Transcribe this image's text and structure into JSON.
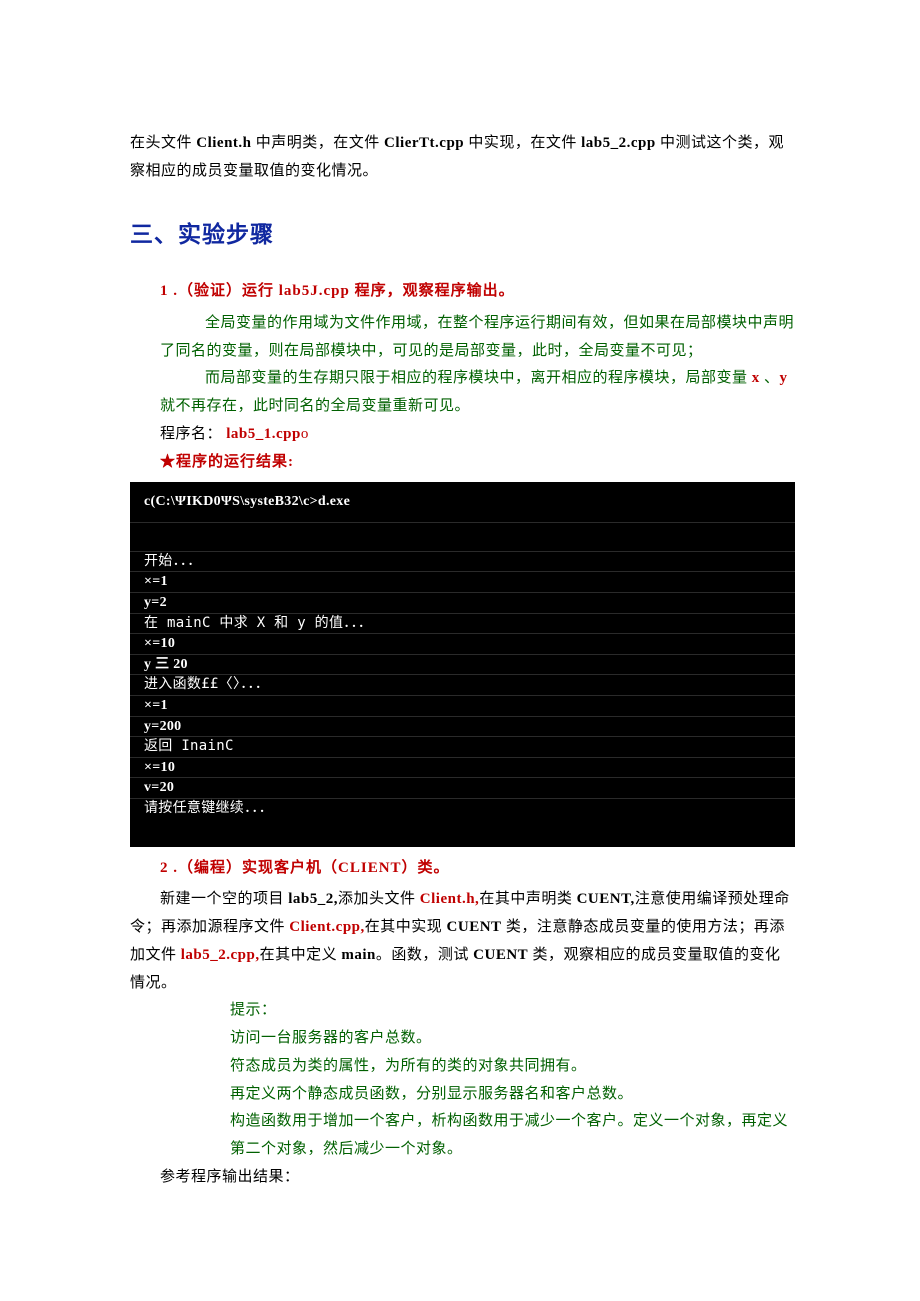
{
  "intro": {
    "p1a": "在头文件",
    "p1b": "Client.h",
    "p1c": "中声明类，在文件",
    "p1d": "ClierTt.cpp",
    "p1e": "中实现，在文件",
    "p1f": "lab5_2.cpp",
    "p1g": "中测试这个类，观察相应的成员变量取值的变化情况。"
  },
  "section_heading": "三、实验步骤",
  "step1": {
    "num": "1",
    "dot": " .（验证）运行",
    "prog": "lab5J.cpp",
    "tail": "程序，观察程序输出。",
    "green1_a": "全局变量的作用域为文件作用域，在整个程序运行期间有效，但如果在局部模块中声明了同名的变量，则在局部模块中，可见的是局部变量，此时，全局变量不可见；",
    "green2_a": "而局部变量的生存期只限于相应的程序模块中，离开相应的程序模块，局部变量",
    "green2_x": " x ",
    "green2_b": "、",
    "green2_y": "y",
    "green2_c": " 就不再存在，此时同名的全局变量重新可见。",
    "progname_label": "程序名：",
    "progname": "lab5_1.cpp",
    "progname_suffix": "o",
    "star": "★",
    "run_result_label": "程序的运行结果:"
  },
  "console": {
    "title": "c(C:\\ΨIKD0ΨS\\systeB32\\c>d.exe",
    "rows": [
      "开始．．．",
      "×=1",
      "y=2",
      "在 mainC 中求 X 和 y 的值．．．",
      "×=10",
      "y 三 20",
      "进入函数££〈〉．．．",
      "×=1",
      "y=200",
      "返回 InainC",
      "×=10",
      "v=20",
      "请按任意键继续．．．"
    ]
  },
  "step2": {
    "num": "2",
    "dot": " .（编程）实现客户机（",
    "client": "CLIENT",
    "tail": "）类。",
    "p_a": "新建一个空的项目",
    "p_b": " lab5_2,",
    "p_c": "添加头文件",
    "p_d": " Client.h,",
    "p_e": "在其中声明类",
    "p_f": " CUENT,",
    "p_g": "注意使用编译预处理命令；再添加源程序文件",
    "p_h": " Client.cpp,",
    "p_i": "在其中实现",
    "p_j": " CUENT",
    "p_k": " 类，注意静态成员变量的使用方法；再添加文件",
    "p_l": " lab5_2.cpp,",
    "p_m": "在其中定义",
    "p_n": " main",
    "p_o": "。函数，测试",
    "p_p": " CUENT",
    "p_q": " 类，观察相应的成员变量取值的变化情况。",
    "hint_label": "提示：",
    "hint1": "访问一台服务器的客户总数。",
    "hint2": "符态成员为类的属性，为所有的类的对象共同拥有。",
    "hint3": "再定义两个静态成员函数，分别显示服务器名和客户总数。",
    "hint4": "构造函数用于增加一个客户，析构函数用于减少一个客户。定义一个对象，再定义第二个对象，然后减少一个对象。",
    "ref_out": "参考程序输出结果："
  }
}
